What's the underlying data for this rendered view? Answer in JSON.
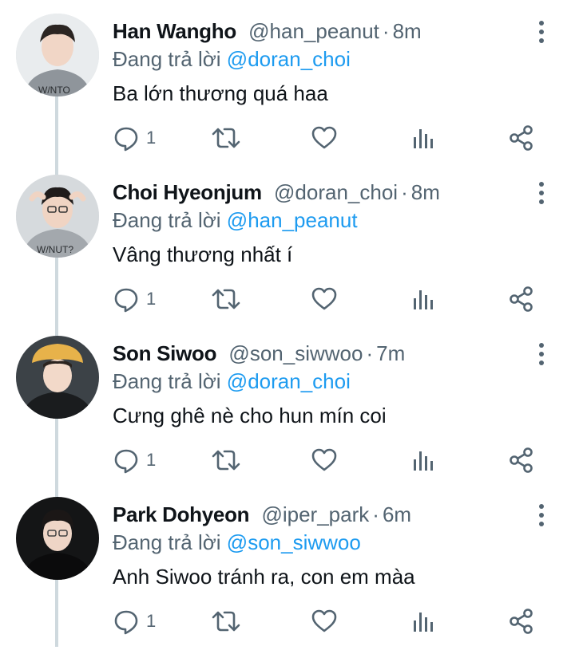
{
  "replies": [
    {
      "name": "Han Wangho",
      "handle": "@han_peanut",
      "separator": "·",
      "time": "8m",
      "reply_prefix": "Đang trả lời",
      "reply_to": "@doran_choi",
      "text": "Ba lớn thương quá haa",
      "reply_count": "1",
      "avatar_icon": "avatar-photo"
    },
    {
      "name": "Choi Hyeonjum",
      "handle": "@doran_choi",
      "separator": "·",
      "time": "8m",
      "reply_prefix": "Đang trả lời",
      "reply_to": "@han_peanut",
      "text": "Vâng thương nhất í",
      "reply_count": "1",
      "avatar_icon": "avatar-photo"
    },
    {
      "name": "Son Siwoo",
      "handle": "@son_siwwoo",
      "separator": "·",
      "time": "7m",
      "reply_prefix": "Đang trả lời",
      "reply_to": "@doran_choi",
      "text": "Cưng ghê nè cho hun mín coi",
      "reply_count": "1",
      "avatar_icon": "avatar-photo"
    },
    {
      "name": "Park Dohyeon",
      "handle": "@iper_park",
      "separator": "·",
      "time": "6m",
      "reply_prefix": "Đang trả lời",
      "reply_to": "@son_siwwoo",
      "text": "Anh Siwoo tránh ra, con em màa",
      "reply_count": "1",
      "avatar_icon": "avatar-photo"
    }
  ],
  "icons": [
    "reply-icon",
    "retweet-icon",
    "like-icon",
    "views-icon",
    "share-icon",
    "more-options-icon"
  ],
  "colors": {
    "text_primary": "#0f1419",
    "text_secondary": "#536471",
    "mention": "#1d9bf0",
    "thread_line": "#cfd9de"
  }
}
